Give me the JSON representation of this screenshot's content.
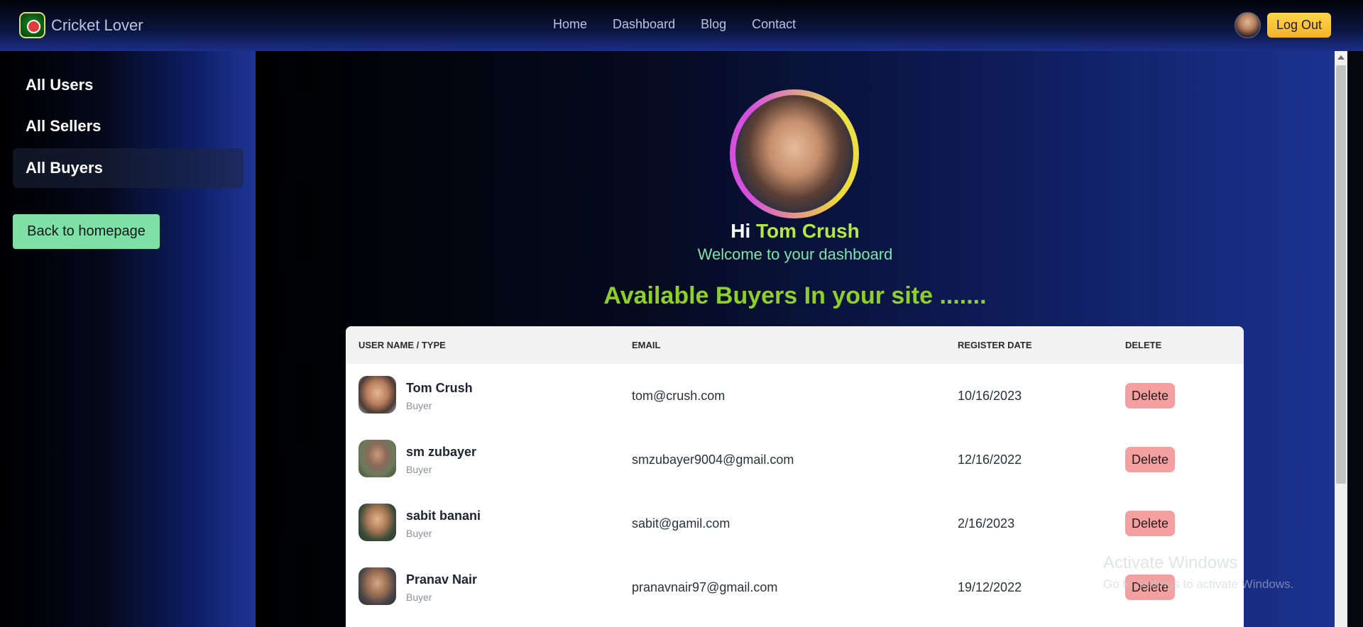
{
  "brand": {
    "name": "Cricket Lover",
    "logo_icon": "cricket-logo-icon"
  },
  "nav": {
    "links": [
      "Home",
      "Dashboard",
      "Blog",
      "Contact"
    ],
    "logout_label": "Log Out"
  },
  "sidebar": {
    "items": [
      {
        "label": "All Users"
      },
      {
        "label": "All Sellers"
      },
      {
        "label": "All Buyers",
        "active": true
      }
    ],
    "back_label": "Back to homepage"
  },
  "profile": {
    "greeting": "Hi",
    "name": "Tom Crush",
    "welcome": "Welcome to your dashboard"
  },
  "section_title": "Available Buyers In your site .......",
  "table": {
    "headers": [
      "USER NAME / TYPE",
      "EMAIL",
      "REGISTER DATE",
      "DELETE"
    ],
    "delete_label": "Delete",
    "rows": [
      {
        "name": "Tom Crush",
        "type": "Buyer",
        "email": "tom@crush.com",
        "date": "10/16/2023"
      },
      {
        "name": "sm zubayer",
        "type": "Buyer",
        "email": "smzubayer9004@gmail.com",
        "date": "12/16/2022"
      },
      {
        "name": "sabit banani",
        "type": "Buyer",
        "email": "sabit@gamil.com",
        "date": "2/16/2023"
      },
      {
        "name": "Pranav Nair",
        "type": "Buyer",
        "email": "pranavnair97@gmail.com",
        "date": "19/12/2022"
      }
    ]
  },
  "watermark": {
    "title": "Activate Windows",
    "subtitle": "Go to Settings to activate Windows."
  },
  "colors": {
    "accent_name": "#b6e844",
    "welcome": "#7ee6a8",
    "section_title": "#8fcf2a",
    "back_button": "#7fe0a6",
    "logout_button": "#f5b22a",
    "delete_button": "#f4a0a0"
  }
}
